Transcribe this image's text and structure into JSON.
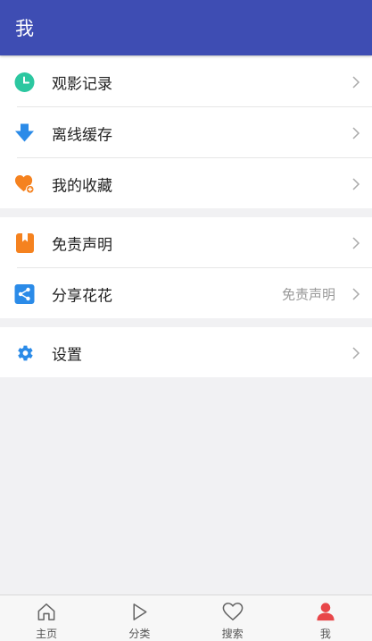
{
  "header": {
    "title": "我"
  },
  "groups": [
    {
      "items": [
        {
          "label": "观影记录",
          "icon": "history-clock-icon",
          "color": "#2cc7a0"
        },
        {
          "label": "离线缓存",
          "icon": "download-arrow-icon",
          "color": "#2b8be8"
        },
        {
          "label": "我的收藏",
          "icon": "heart-plus-icon",
          "color": "#f5821f"
        }
      ]
    },
    {
      "items": [
        {
          "label": "免责声明",
          "icon": "bookmark-book-icon",
          "color": "#f5821f"
        },
        {
          "label": "分享花花",
          "value": "免责声明",
          "icon": "share-icon",
          "color": "#2b8be8"
        }
      ]
    },
    {
      "items": [
        {
          "label": "设置",
          "icon": "gear-icon",
          "color": "#2b8be8"
        }
      ]
    }
  ],
  "tabbar": {
    "items": [
      {
        "label": "主页",
        "icon": "home-icon"
      },
      {
        "label": "分类",
        "icon": "play-icon"
      },
      {
        "label": "搜索",
        "icon": "heart-outline-icon"
      },
      {
        "label": "我",
        "icon": "person-icon",
        "active": true,
        "active_color": "#e8474a"
      }
    ]
  },
  "colors": {
    "primary": "#3e4db3",
    "background": "#f1f1f3"
  }
}
